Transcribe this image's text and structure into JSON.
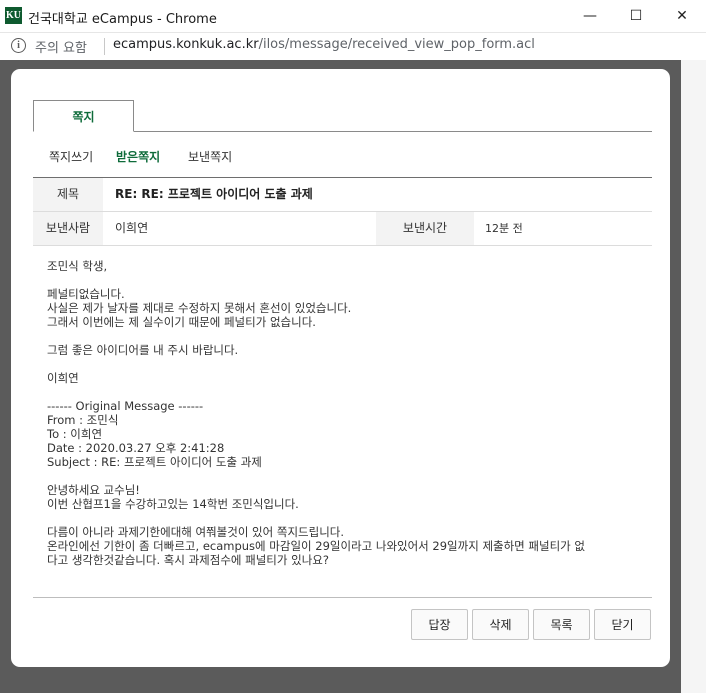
{
  "window": {
    "icon_text": "KU",
    "title": "건국대학교 eCampus - Chrome",
    "minimize": "—",
    "maximize": "☐",
    "close": "✕"
  },
  "address": {
    "info_icon": "i",
    "security_label": "주의 요함",
    "host": "ecampus.konkuk.ac.kr",
    "path": "/ilos/message/received_view_pop_form.acl"
  },
  "tabs": [
    {
      "label": "쪽지"
    }
  ],
  "subnav": [
    {
      "label": "쪽지쓰기",
      "active": false
    },
    {
      "label": "받은쪽지",
      "active": true
    },
    {
      "label": "보낸쪽지",
      "active": false
    }
  ],
  "header": {
    "subject_label": "제목",
    "subject_value": "RE: RE: 프로젝트 아이디어 도출 과제",
    "sender_label": "보낸사람",
    "sender_value": "이희연",
    "sent_time_label": "보낸시간",
    "sent_time_value": "12분 전"
  },
  "body_lines": [
    "조민식 학생,",
    "",
    "페널티없습니다.",
    "사실은 제가 날자를 제대로 수정하지 못해서 혼선이 있었습니다.",
    "그래서 이번에는 제 실수이기 때문에 페널티가 없습니다.",
    "",
    "그럼 좋은 아이디어를 내 주시 바랍니다.",
    "",
    "이희연",
    "",
    "------ Original Message ------",
    "From : 조민식",
    "To : 이희연",
    "Date : 2020.03.27 오후 2:41:28",
    "Subject : RE: 프로젝트 아이디어 도출 과제",
    "",
    "안녕하세요 교수님!",
    "이번 산협프1을 수강하고있는 14학번 조민식입니다.",
    "",
    "다름이 아니라 과제기한에대해 여쭤볼것이 있어 쪽지드립니다.",
    "온라인에선 기한이 좀 더빠르고, ecampus에 마감일이 29일이라고 나와있어서 29일까지 제출하면 패널티가 없",
    "다고 생각한것같습니다. 혹시 과제점수에 패널티가 있나요?"
  ],
  "buttons": {
    "reply": "답장",
    "delete": "삭제",
    "list": "목록",
    "close": "닫기"
  }
}
